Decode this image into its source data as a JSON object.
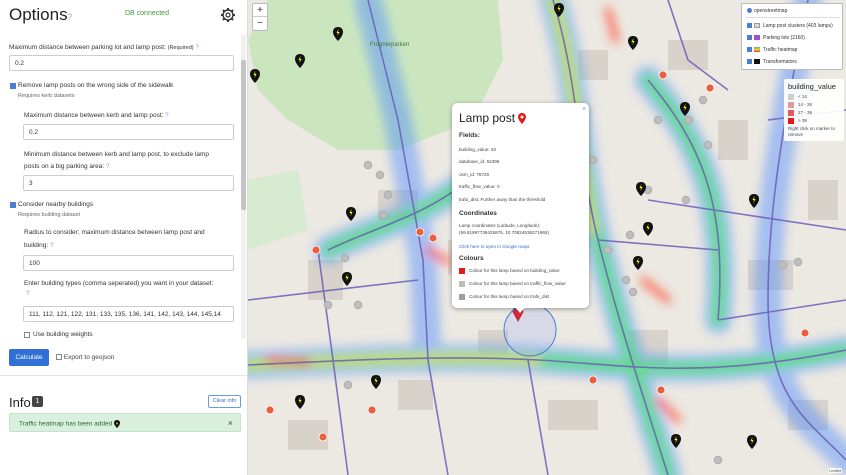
{
  "panel": {
    "title": "Options",
    "title_help": "?",
    "db_status": "DB connected",
    "gear_icon": "gear-icon"
  },
  "form": {
    "max_dist_label": "Maximum distance between parking lot and lamp post:",
    "required": "(Required)",
    "max_dist_value": "0.2",
    "remove_wrong_side_label": "Remove lamp posts on the wrong side of the sidewalk",
    "requires_kerb": "Requires kerb datasets",
    "kerb_dist_label": "Maximum distance between kerb and lamp post:",
    "kerb_dist_value": "0.2",
    "min_kerb_label_1": "Minimum distance between kerb and lamp post, to exclude lamp",
    "min_kerb_label_2": "posts on a big parking area:",
    "min_kerb_value": "3",
    "consider_buildings_label": "Consider nearby buildings",
    "requires_building": "Requires building dataset",
    "radius_label_1": "Radius to consider; maximum distance between lamp post and",
    "radius_label_2": "building:",
    "radius_value": "100",
    "btypes_label": "Enter building types (comma seperated) you want in your dataset:",
    "btypes_value": "111, 112, 121, 122, 131, 133, 135, 136, 141, 142, 143, 144, 145,14",
    "weights_label": "Use building weights",
    "help": "?"
  },
  "actions": {
    "calculate": "Calculate",
    "export": "Export to geojson"
  },
  "info": {
    "title": "Info",
    "count": "1",
    "clear": "Clear info",
    "message": "Traffic heatmap has been added",
    "close": "×"
  },
  "map": {
    "zoom_in": "+",
    "zoom_out": "−",
    "attribution": "Leaflet",
    "place_label": "Frognerparken",
    "layers": {
      "base": "openstreetmap",
      "items": [
        {
          "label": "Lamp post clusters (403 lamps)",
          "color": "#d9d9d9"
        },
        {
          "label": "Parking lots (2160)",
          "color": "#a44bd1"
        },
        {
          "label": "Traffic heatmap",
          "color": "#56c05a"
        },
        {
          "label": "Transformators",
          "color": "#111111"
        }
      ]
    },
    "legend": {
      "title": "building_value",
      "rows": [
        {
          "label": "< 14",
          "color": "#cfcfcf"
        },
        {
          "label": "14 - 26",
          "color": "#e09a9a"
        },
        {
          "label": "27 - 39",
          "color": "#e35a5a"
        },
        {
          "label": "> 39",
          "color": "#e11919"
        }
      ],
      "note": "Right click on marker to remove"
    }
  },
  "popup": {
    "title": "Lamp post",
    "close": "×",
    "fields_heading": "Fields:",
    "fields": [
      "building_value: 40",
      "database_id: 52396",
      "osm_id: 78720",
      "traffic_flow_value: 0",
      "trafo_dist: Further away than the threshold"
    ],
    "coords_heading": "Coordinates",
    "coords_label": "Lamp coordinates (Latitude, Longitude):",
    "coords_value": "(59.91997739425975, 10.70824636271965)",
    "map_link": "Click here to open in Google maps",
    "colours_heading": "Colours",
    "colours": [
      {
        "label": "Colour for this lamp based on building_value",
        "color": "#e11919"
      },
      {
        "label": "Colour for this lamp based on traffic_flow_value",
        "color": "#bdbdbd"
      },
      {
        "label": "Colour for this lamp based on trafo_dist",
        "color": "#9e9e9e"
      }
    ]
  }
}
